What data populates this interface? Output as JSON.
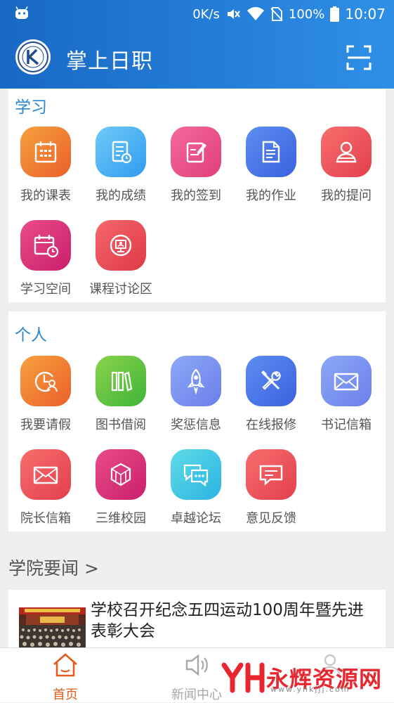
{
  "status": {
    "speed": "0K/s",
    "battery": "100%",
    "time": "10:07"
  },
  "app": {
    "title": "掌上日职"
  },
  "study": {
    "title": "学习",
    "items": [
      {
        "label": "我的课表",
        "icon": "calendar-icon"
      },
      {
        "label": "我的成绩",
        "icon": "grade-report-icon"
      },
      {
        "label": "我的签到",
        "icon": "checkin-icon"
      },
      {
        "label": "我的作业",
        "icon": "homework-icon"
      },
      {
        "label": "我的提问",
        "icon": "question-user-icon"
      },
      {
        "label": "学习空间",
        "icon": "study-calendar-icon"
      },
      {
        "label": "课程讨论区",
        "icon": "presentation-icon"
      }
    ]
  },
  "personal": {
    "title": "个人",
    "items": [
      {
        "label": "我要请假",
        "icon": "leave-clock-icon"
      },
      {
        "label": "图书借阅",
        "icon": "books-icon"
      },
      {
        "label": "奖惩信息",
        "icon": "rocket-icon"
      },
      {
        "label": "在线报修",
        "icon": "tools-icon"
      },
      {
        "label": "书记信箱",
        "icon": "mail-icon"
      },
      {
        "label": "院长信箱",
        "icon": "mail-icon"
      },
      {
        "label": "三维校园",
        "icon": "cube-icon"
      },
      {
        "label": "卓越论坛",
        "icon": "chat-bubbles-icon"
      },
      {
        "label": "意见反馈",
        "icon": "feedback-icon"
      }
    ]
  },
  "news": {
    "header": "学院要闻 >",
    "items": [
      {
        "title": "学校召开纪念五四运动100周年暨先进表彰大会"
      }
    ]
  },
  "tabs": [
    {
      "label": "首页",
      "active": true,
      "icon": "home-icon"
    },
    {
      "label": "新闻中心",
      "active": false,
      "icon": "speaker-icon"
    }
  ],
  "watermark": {
    "brand": "永辉资源网",
    "url": "www.yhkjjj.com"
  },
  "colors": {
    "header_start": "#1768c4",
    "header_end": "#2f8fe6",
    "section_title": "#2a86cf",
    "tab_active": "#e15c1c",
    "tab_inactive": "#a8a8a8"
  }
}
